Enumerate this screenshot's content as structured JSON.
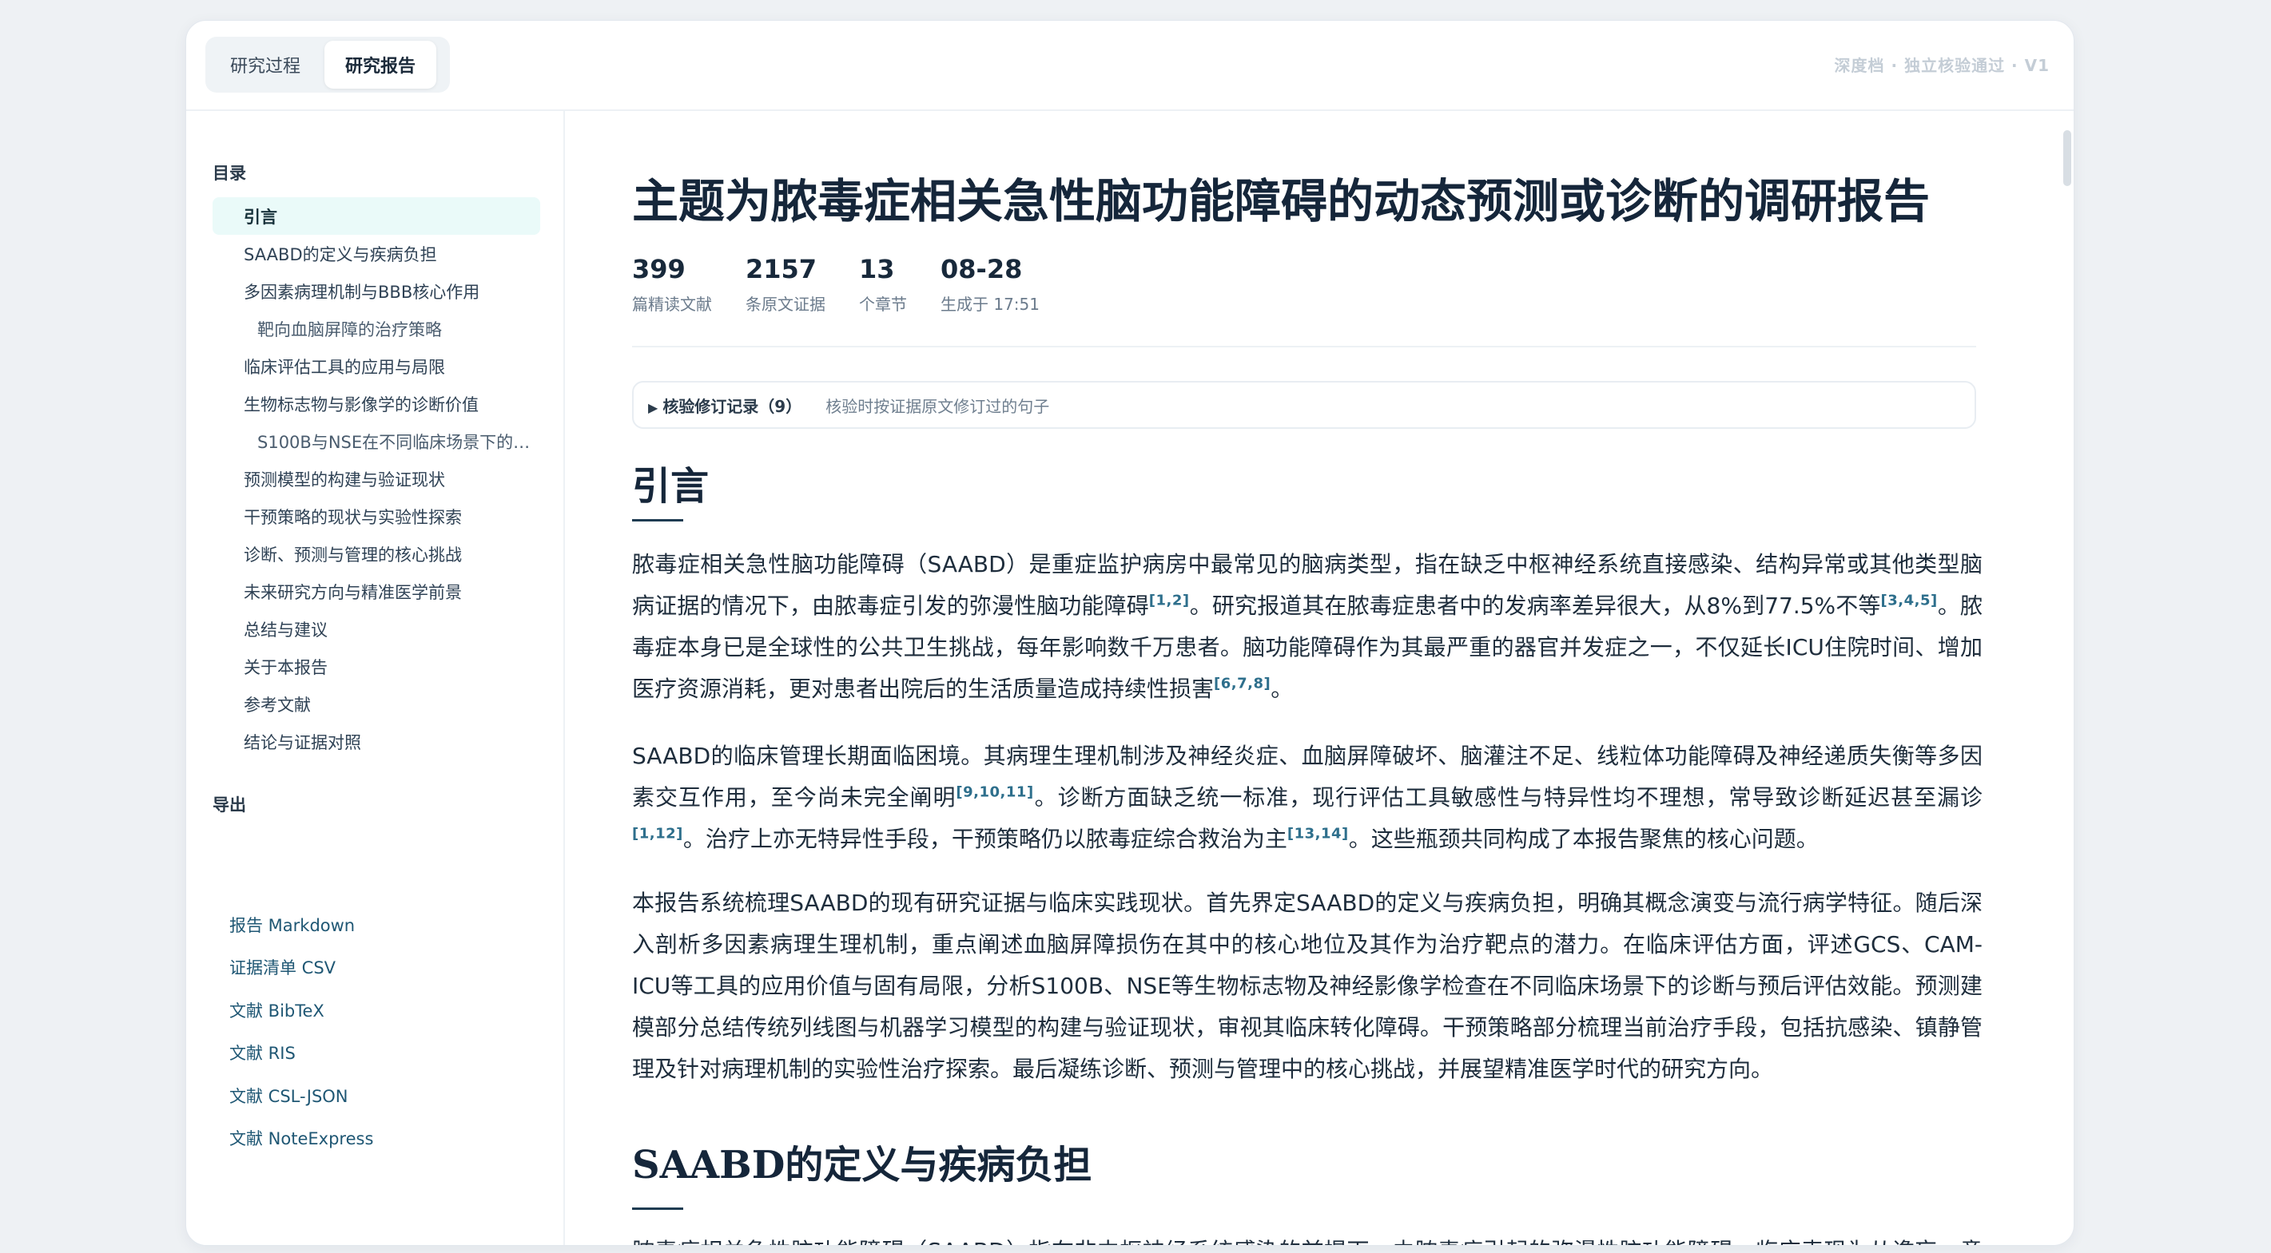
{
  "tabs": [
    {
      "label": "研究过程",
      "active": false
    },
    {
      "label": "研究报告",
      "active": true
    }
  ],
  "status": "深度档 · 独立核验通过 · V1",
  "sidebar": {
    "toc_heading": "目录",
    "toc": [
      {
        "label": "引言",
        "active": true,
        "sub": false
      },
      {
        "label": "SAABD的定义与疾病负担",
        "sub": false
      },
      {
        "label": "多因素病理机制与BBB核心作用",
        "sub": false
      },
      {
        "label": "靶向血脑屏障的治疗策略",
        "sub": true
      },
      {
        "label": "临床评估工具的应用与局限",
        "sub": false
      },
      {
        "label": "生物标志物与影像学的诊断价值",
        "sub": false
      },
      {
        "label": "S100B与NSE在不同临床场景下的…",
        "sub": true
      },
      {
        "label": "预测模型的构建与验证现状",
        "sub": false
      },
      {
        "label": "干预策略的现状与实验性探索",
        "sub": false
      },
      {
        "label": "诊断、预测与管理的核心挑战",
        "sub": false
      },
      {
        "label": "未来研究方向与精准医学前景",
        "sub": false
      },
      {
        "label": "总结与建议",
        "sub": false
      },
      {
        "label": "关于本报告",
        "sub": false
      },
      {
        "label": "参考文献",
        "sub": false
      },
      {
        "label": "结论与证据对照",
        "sub": false
      }
    ],
    "export_heading": "导出",
    "exports": [
      "报告 Markdown",
      "证据清单 CSV",
      "文献 BibTeX",
      "文献 RIS",
      "文献 CSL-JSON",
      "文献 NoteExpress"
    ]
  },
  "report": {
    "title": "主题为脓毒症相关急性脑功能障碍的动态预测或诊断的调研报告",
    "stats": [
      {
        "value": "399",
        "label": "篇精读文献"
      },
      {
        "value": "2157",
        "label": "条原文证据"
      },
      {
        "value": "13",
        "label": "个章节"
      },
      {
        "value": "08-28",
        "label": "生成于 17:51"
      }
    ],
    "revision": {
      "toggle": "核验修订记录（9）",
      "desc": "核验时按证据原文修订过的句子"
    },
    "sections": [
      {
        "heading": "引言",
        "paragraphs": [
          [
            {
              "t": "脓毒症相关急性脑功能障碍（SAABD）是重症监护病房中最常见的脑病类型，指在缺乏中枢神经系统直接感染、结构异常或其他类型脑病证据的情况下，由脓毒症引发的弥漫性脑功能障碍"
            },
            {
              "c": "[1,2]"
            },
            {
              "t": "。研究报道其在脓毒症患者中的发病率差异很大，从8%到77.5%不等"
            },
            {
              "c": "[3,4,5]"
            },
            {
              "t": "。脓毒症本身已是全球性的公共卫生挑战，每年影响数千万患者。脑功能障碍作为其最严重的器官并发症之一，不仅延长ICU住院时间、增加医疗资源消耗，更对患者出院后的生活质量造成持续性损害"
            },
            {
              "c": "[6,7,8]"
            },
            {
              "t": "。"
            }
          ],
          [
            {
              "t": "SAABD的临床管理长期面临困境。其病理生理机制涉及神经炎症、血脑屏障破坏、脑灌注不足、线粒体功能障碍及神经递质失衡等多因素交互作用，至今尚未完全阐明"
            },
            {
              "c": "[9,10,11]"
            },
            {
              "t": "。诊断方面缺乏统一标准，现行评估工具敏感性与特异性均不理想，常导致诊断延迟甚至漏诊"
            },
            {
              "c": "[1,12]"
            },
            {
              "t": "。治疗上亦无特异性手段，干预策略仍以脓毒症综合救治为主"
            },
            {
              "c": "[13,14]"
            },
            {
              "t": "。这些瓶颈共同构成了本报告聚焦的核心问题。"
            }
          ],
          [
            {
              "t": "本报告系统梳理SAABD的现有研究证据与临床实践现状。首先界定SAABD的定义与疾病负担，明确其概念演变与流行病学特征。随后深入剖析多因素病理生理机制，重点阐述血脑屏障损伤在其中的核心地位及其作为治疗靶点的潜力。在临床评估方面，评述GCS、CAM-ICU等工具的应用价值与固有局限，分析S100B、NSE等生物标志物及神经影像学检查在不同临床场景下的诊断与预后评估效能。预测建模部分总结传统列线图与机器学习模型的构建与验证现状，审视其临床转化障碍。干预策略部分梳理当前治疗手段，包括抗感染、镇静管理及针对病理机制的实验性治疗探索。最后凝练诊断、预测与管理中的核心挑战，并展望精准医学时代的研究方向。"
            }
          ]
        ]
      },
      {
        "heading": "SAABD的定义与疾病负担",
        "paragraphs": [
          [
            {
              "t": "脓毒症相关急性脑功能障碍（SAABD）指在非中枢神经系统感染的前提下，由脓毒症引起的弥漫性脑功能障碍，临床表现为从谵妄、意识改变到昏迷等不同程度的神经功能异常。"
            }
          ]
        ]
      }
    ]
  }
}
